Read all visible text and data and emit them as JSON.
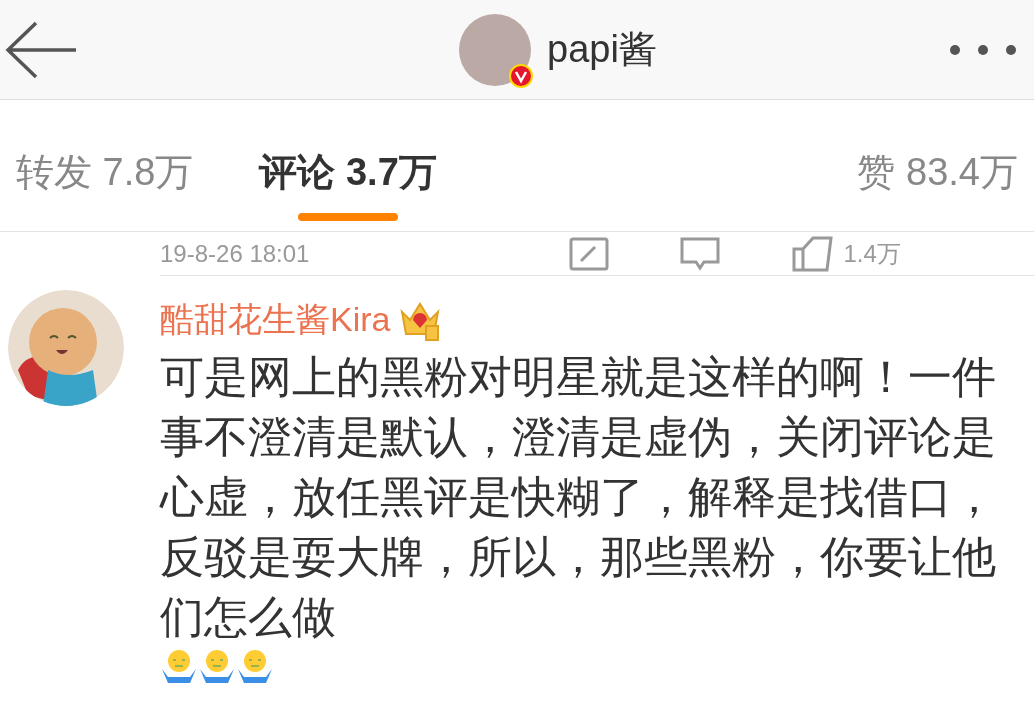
{
  "header": {
    "title": "papi酱",
    "verified": true
  },
  "tabs": [
    {
      "label": "转发",
      "count": "7.8万",
      "selected": false
    },
    {
      "label": "评论",
      "count": "3.7万",
      "selected": true
    },
    {
      "label": "赞",
      "count": "83.4万",
      "selected": false
    }
  ],
  "post_meta": {
    "time": "19-8-26 18:01",
    "like_count": "1.4万"
  },
  "comments": [
    {
      "user": "酷甜花生酱Kira",
      "text": "可是网上的黑粉对明星就是这样的啊！一件事不澄清是默认，澄清是虚伪，关闭评论是心虚，放任黑评是快糊了，解释是找借口，反驳是耍大牌，所以，那些黑粉，你要让他们怎么做",
      "emojis": [
        {
          "kind": "shrug"
        },
        {
          "kind": "shrug"
        },
        {
          "kind": "shrug"
        }
      ]
    }
  ]
}
